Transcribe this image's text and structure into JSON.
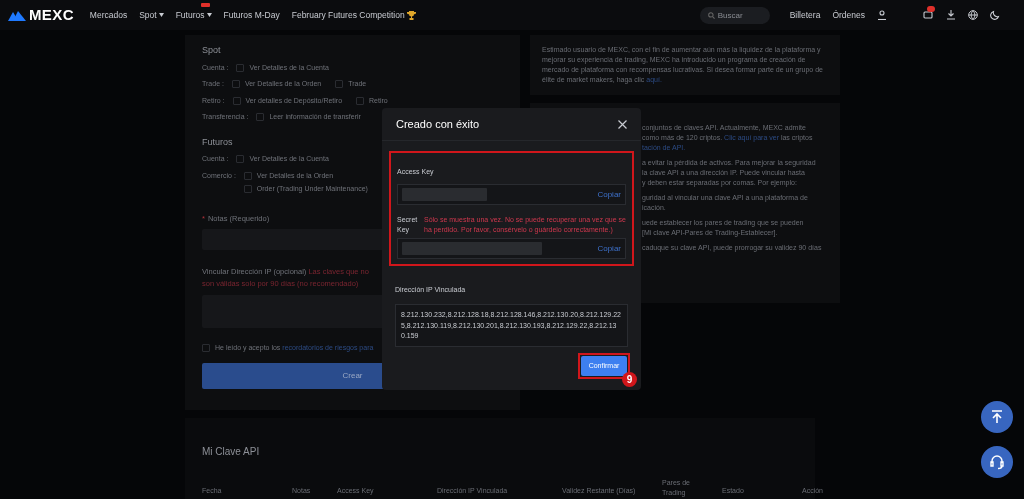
{
  "nav": {
    "logo": "MEXC",
    "items": [
      {
        "label": "Mercados",
        "dropdown": false,
        "hot": false
      },
      {
        "label": "Spot",
        "dropdown": true,
        "hot": false
      },
      {
        "label": "Futuros",
        "dropdown": true,
        "hot": true
      },
      {
        "label": "Futuros M-Day",
        "dropdown": false,
        "hot": false
      },
      {
        "label": "February Futures Competition",
        "dropdown": false,
        "hot": false,
        "trophy": true
      }
    ],
    "search": {
      "placeholder": "Buscar"
    },
    "links": [
      "Billetera",
      "Órdenes"
    ]
  },
  "form": {
    "sections": [
      {
        "title": "Spot",
        "rows": [
          {
            "kind": "inline",
            "label": "Cuenta :",
            "options": [
              {
                "label": "Ver Detalles de la Cuenta",
                "checked": false
              }
            ]
          },
          {
            "kind": "inline",
            "label": "Trade :",
            "options": [
              {
                "label": "Ver Detalles de la Orden",
                "checked": false
              },
              {
                "label": "Trade",
                "checked": false
              }
            ]
          },
          {
            "kind": "inline",
            "label": "Retiro :",
            "options": [
              {
                "label": "Ver detalles de Depósito/Retiro",
                "checked": false
              },
              {
                "label": "Retiro",
                "checked": false
              }
            ]
          },
          {
            "kind": "inline",
            "label": "Transferencia :",
            "options": [
              {
                "label": "Leer información de transferir",
                "checked": false
              }
            ]
          }
        ]
      },
      {
        "title": "Futuros",
        "rows": [
          {
            "kind": "inline",
            "label": "Cuenta :",
            "options": [
              {
                "label": "Ver Detalles de la Cuenta",
                "checked": false
              }
            ]
          },
          {
            "kind": "stacked",
            "label": "Comercio :",
            "options": [
              {
                "label": "Ver Detalles de la Orden",
                "checked": false
              },
              {
                "label": "Order (Trading Under Maintenance)",
                "checked": false
              }
            ]
          }
        ]
      }
    ],
    "notes_required_mark": "*",
    "notes_label": "Notas (Requerido)",
    "ip_label": "Vincular Dirección IP (opcional)",
    "ip_warning_1": "Las claves que no",
    "ip_warning_2": "son válidas solo por 90 días (no recomendado)",
    "agree": {
      "checked": false,
      "text": "He leído y acepto los",
      "link": "recordatorios de riesgos para"
    },
    "submit": "Crear"
  },
  "info": {
    "promo": "Estimado usuario de MEXC, con el fin de aumentar aún más la liquidez de la plataforma y mejorar su experiencia de trading, MEXC ha introducido un programa de creación de mercado de plataforma con recompensas lucrativas. Si desea formar parte de un grupo de élite de market makers, haga clic",
    "promo_link": "aquí.",
    "paragraphs": [
      [
        {
          "text": "conjuntos de claves API. Actualmente, MEXC admite"
        },
        {
          "text": "como más de 120 criptos.",
          "link": "Clic aquí para ver",
          "after": "las criptos"
        },
        {
          "link": "tación de API."
        }
      ],
      [
        {
          "text": "a evitar la pérdida de activos. Para mejorar la seguridad"
        },
        {
          "text": "la clave API a una dirección IP. Puede vincular hasta"
        },
        {
          "text": "y deben estar separadas por comas. Por ejemplo:"
        }
      ],
      [
        {
          "text": "guridad al vincular una clave API a una plataforma de"
        },
        {
          "text": "icación."
        }
      ],
      [
        {
          "text": "uede establecer los pares de trading que se pueden"
        },
        {
          "text": "[Mi clave API-Pares de Trading-Establecer]."
        }
      ],
      [
        {
          "text": "caduque su clave API, puede prorrogar su validez 90 días"
        }
      ]
    ]
  },
  "api_list": {
    "title": "Mi Clave API",
    "columns": [
      "Fecha",
      "Notas",
      "Access Key",
      "Dirección IP Vinculada",
      "Validez Restante (Días)",
      "Pares de Trading",
      "Estado",
      "Acción"
    ]
  },
  "modal": {
    "title": "Creado con éxito",
    "access_key_label": "Access Key",
    "secret_key_label": "Secret Key",
    "secret_warning": "Sólo se muestra una vez. No se puede recuperar una vez que se ha perdido. Por favor, consérvelo o guárdelo correctamente.)",
    "copy": [
      "Copiar",
      "Copiar"
    ],
    "ip_label": "Dirección IP Vinculada",
    "ip_value": "8.212.130.232,8.212.128.18,8.212.128.146,8.212.130.20,8.212.129.225,8.212.130.119,8.212.130.201,8.212.130.193,8.212.129.22,8.212.130.159",
    "confirm": "Confirmar",
    "step": "9"
  }
}
